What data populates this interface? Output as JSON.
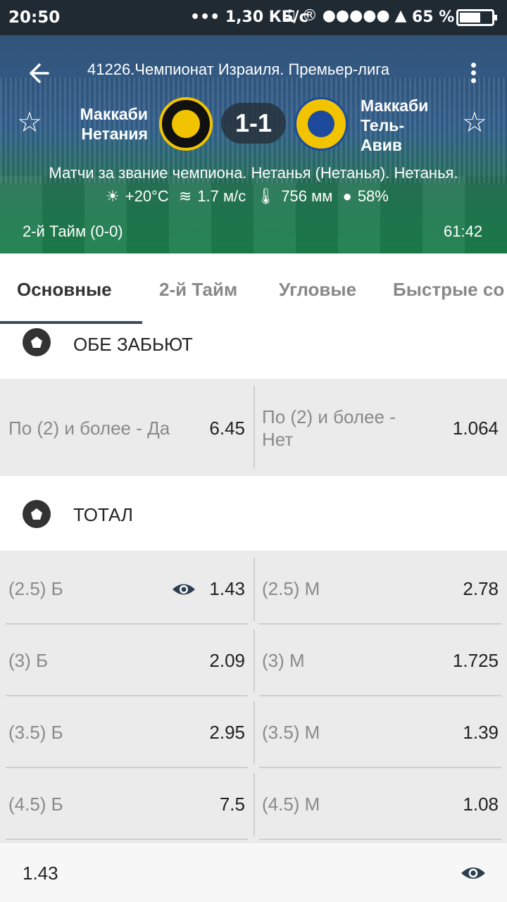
{
  "status_bar": {
    "time": "20:50",
    "network": "••• 1,30 КБ/с",
    "icons": "♫ ® ●●●●● ▲",
    "battery": "65 %",
    "battery_level": 0.65
  },
  "header": {
    "league": "41226.Чемпионат Израиля. Премьер-лига",
    "team_home": "Маккаби Нетания",
    "team_away": "Маккаби Тель-Авив",
    "score": "1-1",
    "venue": "Матчи за звание чемпиона. Нетанья (Нетанья). Нетанья.",
    "weather": {
      "temp": "+20°C",
      "wind": "1.7 м/с",
      "pressure": "756 мм",
      "humidity": "58%"
    },
    "period": "2-й  Тайм (0-0)",
    "timer": "61:42",
    "colors": {
      "home_logo": "#f2c400",
      "away_logo": "#1d4a9c"
    }
  },
  "tabs": [
    {
      "label": "Основные",
      "active": true
    },
    {
      "label": "2-й  Тайм",
      "active": false
    },
    {
      "label": "Угловые",
      "active": false
    },
    {
      "label": "Быстрые со",
      "active": false
    }
  ],
  "sections": {
    "both_score": {
      "title": "ОБЕ ЗАБЬЮТ",
      "row": [
        {
          "label": "По (2) и более - Да",
          "value": "6.45"
        },
        {
          "label": "По (2) и более - Нет",
          "value": "1.064"
        }
      ]
    },
    "total": {
      "title": "ТОТАЛ",
      "rows": [
        [
          {
            "label": "(2.5) Б",
            "value": "1.43",
            "watched": true
          },
          {
            "label": "(2.5) М",
            "value": "2.78"
          }
        ],
        [
          {
            "label": "(3) Б",
            "value": "2.09"
          },
          {
            "label": "(3) М",
            "value": "1.725"
          }
        ],
        [
          {
            "label": "(3.5) Б",
            "value": "2.95"
          },
          {
            "label": "(3.5) М",
            "value": "1.39"
          }
        ],
        [
          {
            "label": "(4.5) Б",
            "value": "7.5"
          },
          {
            "label": "(4.5) М",
            "value": "1.08"
          }
        ]
      ]
    }
  },
  "bottom_bar": {
    "value": "1.43"
  }
}
